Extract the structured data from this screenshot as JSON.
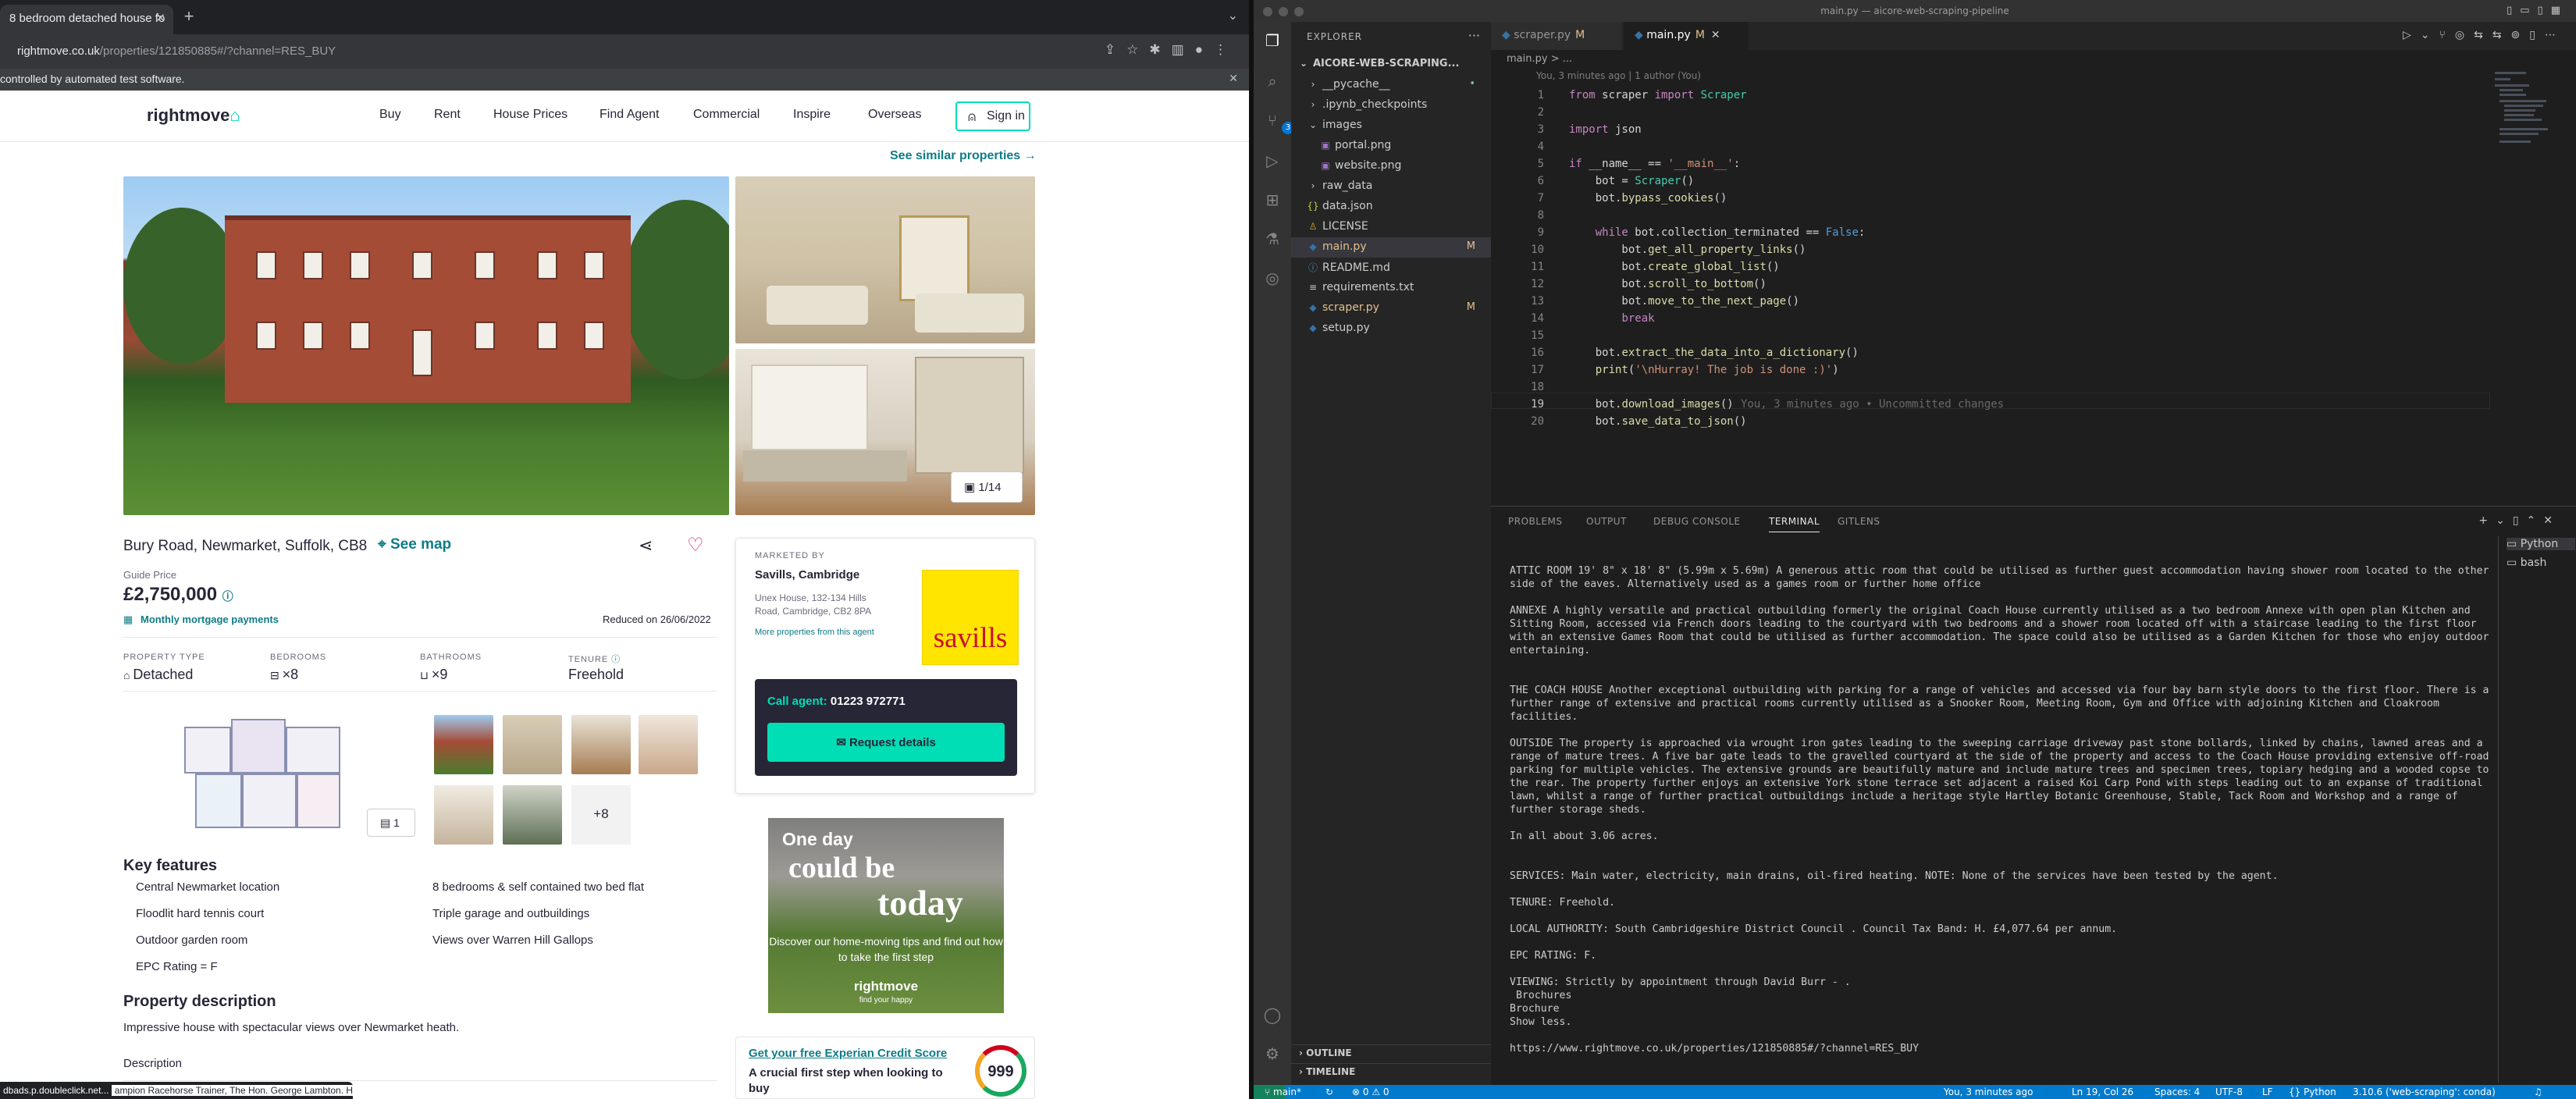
{
  "browser": {
    "tab_title": "8 bedroom detached house fo",
    "url_domain": "rightmove.co.uk",
    "url_path": "/properties/121850885#/?channel=RES_BUY",
    "automation_notice": "controlled by automated test software.",
    "status_url": "dbads.p.doubleclick.net..."
  },
  "rightmove": {
    "logo": "rightmove",
    "nav": [
      "Buy",
      "Rent",
      "House Prices",
      "Find Agent",
      "Commercial",
      "Inspire",
      "Overseas"
    ],
    "signin": "Sign in",
    "see_similar": "See similar properties",
    "photo_counter": "1/14",
    "address": "Bury Road, Newmarket, Suffolk, CB8",
    "see_map": "See map",
    "guide_price_label": "Guide Price",
    "price": "£2,750,000",
    "mortgage_link": "Monthly mortgage payments",
    "reduced": "Reduced on 26/06/2022",
    "details": [
      {
        "label": "PROPERTY TYPE",
        "value": "Detached"
      },
      {
        "label": "BEDROOMS",
        "value": "×8"
      },
      {
        "label": "BATHROOMS",
        "value": "×9"
      },
      {
        "label": "TENURE",
        "value": "Freehold"
      }
    ],
    "floorplan_count": "1",
    "more_photos": "+8",
    "key_features_title": "Key features",
    "key_features": [
      "Central Newmarket location",
      "8 bedrooms & self contained two bed flat",
      "Floodlit hard tennis court",
      "Triple garage and outbuildings",
      "Outdoor garden room",
      "Views over Warren Hill Gallops",
      "EPC Rating = F"
    ],
    "property_description_title": "Property description",
    "description_headline": "Impressive house with spectacular views over Newmarket heath.",
    "description_label": "Description",
    "description_cut": "ampion Racehorse Trainer, The Hon. George Lambton. He trained",
    "agent": {
      "marketed_by": "MARKETED BY",
      "name": "Savills, Cambridge",
      "address": "Unex House, 132-134 Hills Road, Cambridge, CB2 8PA",
      "more_link": "More properties from this agent",
      "logo_text": "savills",
      "call_label": "Call agent:",
      "phone": "01223 972771",
      "request_button": "Request details"
    },
    "ad": {
      "line1": "One day",
      "line2": "could be",
      "line3": "today",
      "sub": "Discover our home-moving tips and find out how to take the first step",
      "brand": "rightmove",
      "tagline": "find your happy"
    },
    "experian": {
      "title": "Get your free Experian Credit Score",
      "body": "A crucial first step when looking to buy",
      "score": "999"
    }
  },
  "vscode": {
    "window_title": "main.py — aicore-web-scraping-pipeline",
    "explorer_title": "EXPLORER",
    "root_folder": "AICORE-WEB-SCRAPING...",
    "files": [
      {
        "name": "__pycache__",
        "kind": "folder",
        "status": "•"
      },
      {
        "name": ".ipynb_checkpoints",
        "kind": "folder",
        "status": ""
      },
      {
        "name": "images",
        "kind": "folder",
        "status": ""
      },
      {
        "name": "portal.png",
        "kind": "image",
        "status": ""
      },
      {
        "name": "website.png",
        "kind": "image",
        "status": ""
      },
      {
        "name": "raw_data",
        "kind": "folder",
        "status": ""
      },
      {
        "name": "data.json",
        "kind": "json",
        "status": ""
      },
      {
        "name": "LICENSE",
        "kind": "file",
        "status": ""
      },
      {
        "name": "main.py",
        "kind": "py",
        "status": "M"
      },
      {
        "name": "README.md",
        "kind": "md",
        "status": ""
      },
      {
        "name": "requirements.txt",
        "kind": "txt",
        "status": ""
      },
      {
        "name": "scraper.py",
        "kind": "py",
        "status": "M"
      },
      {
        "name": "setup.py",
        "kind": "py",
        "status": ""
      }
    ],
    "outline": "OUTLINE",
    "timeline": "TIMELINE",
    "tabs": [
      {
        "name": "scraper.py",
        "mark": "M"
      },
      {
        "name": "main.py",
        "mark": "M"
      }
    ],
    "breadcrumb": "main.py > ...",
    "blame_header": "You, 3 minutes ago | 1 author (You)",
    "code_lines": [
      "from scraper import Scraper",
      "",
      "import json",
      "",
      "if __name__ == '__main__':",
      "    bot = Scraper()",
      "    bot.bypass_cookies()",
      "",
      "    while bot.collection_terminated == False:",
      "        bot.get_all_property_links()",
      "        bot.create_global_list()",
      "        bot.scroll_to_bottom()",
      "        bot.move_to_the_next_page()",
      "        break",
      "",
      "    bot.extract_the_data_into_a_dictionary()",
      "    print('\\nHurray! The job is done :)')",
      "",
      "    bot.download_images()",
      "    bot.save_data_to_json()"
    ],
    "ghost_text": "You, 3 minutes ago • Uncommitted changes",
    "panel_tabs": [
      "PROBLEMS",
      "OUTPUT",
      "DEBUG CONSOLE",
      "TERMINAL",
      "GITLENS"
    ],
    "terminal_lines": [
      "ATTIC ROOM 19' 8\" x 18' 8\" (5.99m x 5.69m) A generous attic room that could be utilised as further guest accommodation having shower room located to the other side of the eaves. Alternatively used as a games room or further home office",
      "",
      "ANNEXE A highly versatile and practical outbuilding formerly the original Coach House currently utilised as a two bedroom Annexe with open plan Kitchen and Sitting Room, accessed via French doors leading to the courtyard with two bedrooms and a shower room located off with a staircase leading to the first floor with an extensive Games Room that could be utilised as further accommodation. The space could also be utilised as a Garden Kitchen for those who enjoy outdoor entertaining.",
      "",
      "",
      "THE COACH HOUSE Another exceptional outbuilding with parking for a range of vehicles and accessed via four bay barn style doors to the first floor. There is a further range of extensive and practical rooms currently utilised as a Snooker Room, Meeting Room, Gym and Office with adjoining Kitchen and Cloakroom facilities.",
      "",
      "OUTSIDE The property is approached via wrought iron gates leading to the sweeping carriage driveway past stone bollards, linked by chains, lawned areas and a range of mature trees. A five bar gate leads to the gravelled courtyard at the side of the property and access to the Coach House providing extensive off-road parking for multiple vehicles. The extensive grounds are beautifully mature and include mature trees and specimen trees, topiary hedging and a wooded copse to the rear. The property further enjoys an extensive York stone terrace set adjacent a raised Koi Carp Pond with steps leading out to an expanse of traditional lawn, whilst a range of further practical outbuildings include a heritage style Hartley Botanic Greenhouse, Stable, Tack Room and Workshop and a range of further storage sheds.",
      "",
      "In all about 3.06 acres.",
      "",
      "",
      "SERVICES: Main water, electricity, main drains, oil-fired heating. NOTE: None of the services have been tested by the agent.",
      "",
      "TENURE: Freehold.",
      "",
      "LOCAL AUTHORITY: South Cambridgeshire District Council . Council Tax Band: H. £4,077.64 per annum.",
      "",
      "EPC RATING: F.",
      "",
      "VIEWING: Strictly by appointment through David Burr - .",
      " Brochures",
      "Brochure",
      "Show less.",
      "",
      "https://www.rightmove.co.uk/properties/121850885#/?channel=RES_BUY"
    ],
    "terminals": [
      "Python",
      "bash"
    ],
    "status": {
      "branch": "main*",
      "problems": "⊗ 0 ⚠ 0",
      "blame": "You, 3 minutes ago",
      "position": "Ln 19, Col 26",
      "spaces": "Spaces: 4",
      "encoding": "UTF-8",
      "eol": "LF",
      "language": "Python",
      "interpreter": "3.10.6 ('web-scraping': conda)"
    }
  }
}
